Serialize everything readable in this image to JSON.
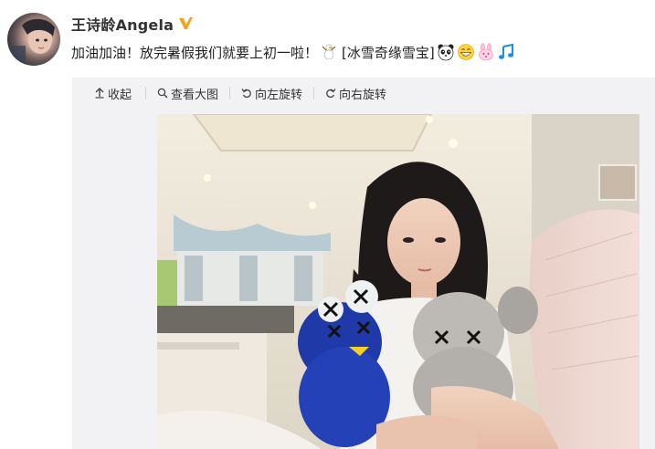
{
  "author": {
    "name": "王诗龄Angela"
  },
  "post": {
    "text": "加油加油！放完暑假我们就要上初一啦！",
    "tag_label": "[冰雪奇缘雪宝]"
  },
  "toolbar": {
    "collapse_label": "收起",
    "view_large_label": "查看大图",
    "rotate_left_label": "向左旋转",
    "rotate_right_label": "向右旋转"
  },
  "icons": {
    "verified": "verified-badge-icon",
    "collapse": "arrow-up-icon",
    "zoom": "search-icon",
    "rotate_left": "rotate-left-icon",
    "rotate_right": "rotate-right-icon"
  },
  "colors": {
    "verified_badge": "#f7a21a",
    "panel_bg": "#f2f2f5"
  }
}
